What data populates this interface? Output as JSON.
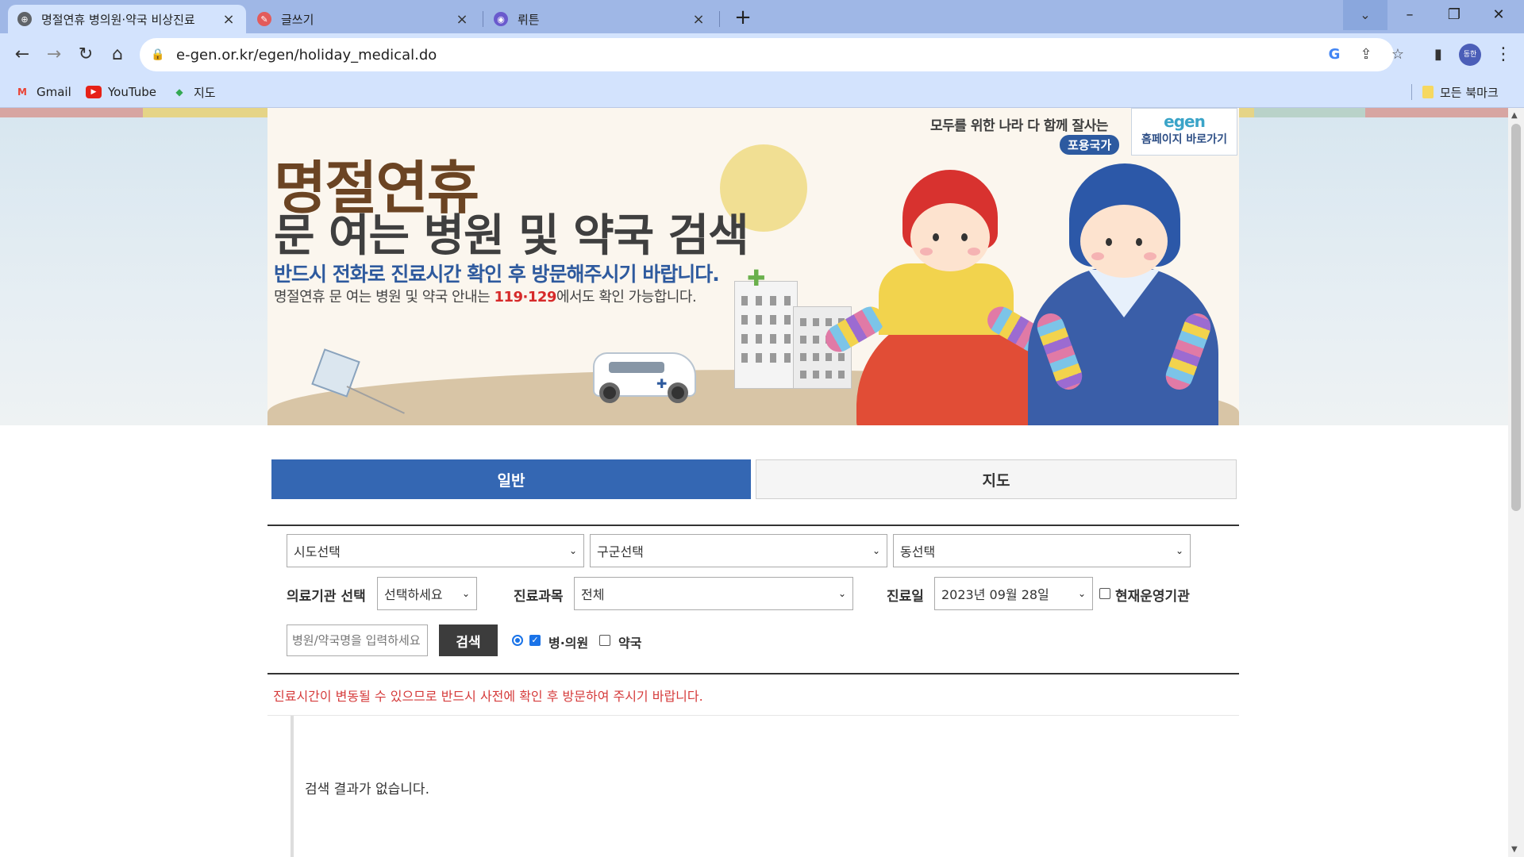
{
  "browser": {
    "tabs": [
      {
        "title": "명절연휴 병의원·약국 비상진료",
        "active": true
      },
      {
        "title": "글쓰기",
        "active": false
      },
      {
        "title": "뤼튼",
        "active": false
      }
    ],
    "new_tab_symbol": "+",
    "url": "e-gen.or.kr/egen/holiday_medical.do",
    "profile_label": "동한",
    "bookmarks": [
      {
        "label": "Gmail",
        "icon": "gmail-icon"
      },
      {
        "label": "YouTube",
        "icon": "youtube-icon"
      },
      {
        "label": "지도",
        "icon": "maps-icon"
      }
    ],
    "all_bookmarks": "모든 북마크"
  },
  "banner": {
    "title_main": "명절연휴",
    "title_sub": "문 여는 병원 및 약국 검색",
    "notice": "반드시 전화로 진료시간 확인 후 방문해주시기 바랍니다.",
    "info_prefix": "명절연휴 문 여는 병원 및 약국 안내는 ",
    "info_numbers": "119·129",
    "info_suffix": "에서도 확인 가능합니다.",
    "slogan": "모두를 위한 나라 다 함께 잘사는",
    "slogan_badge": "포용국가",
    "home_logo": "egen",
    "home_link": "홈페이지 바로가기"
  },
  "view_tabs": {
    "general": "일반",
    "map": "지도"
  },
  "form": {
    "sido": "시도선택",
    "gugun": "구군선택",
    "dong": "동선택",
    "institution_label": "의료기관 선택",
    "institution_value": "선택하세요",
    "department_label": "진료과목",
    "department_value": "전체",
    "date_label": "진료일",
    "date_value": "2023년 09월 28일",
    "open_now_label": "현재운영기관",
    "name_placeholder": "병원/약국명을 입력하세요",
    "search_button": "검색",
    "hospital_label": "병·의원",
    "pharmacy_label": "약국"
  },
  "notice": "진료시간이 변동될 수 있으므로 반드시 사전에 확인 후 방문하여 주시기 바랍니다.",
  "results": {
    "empty_message": "검색 결과가 없습니다."
  }
}
